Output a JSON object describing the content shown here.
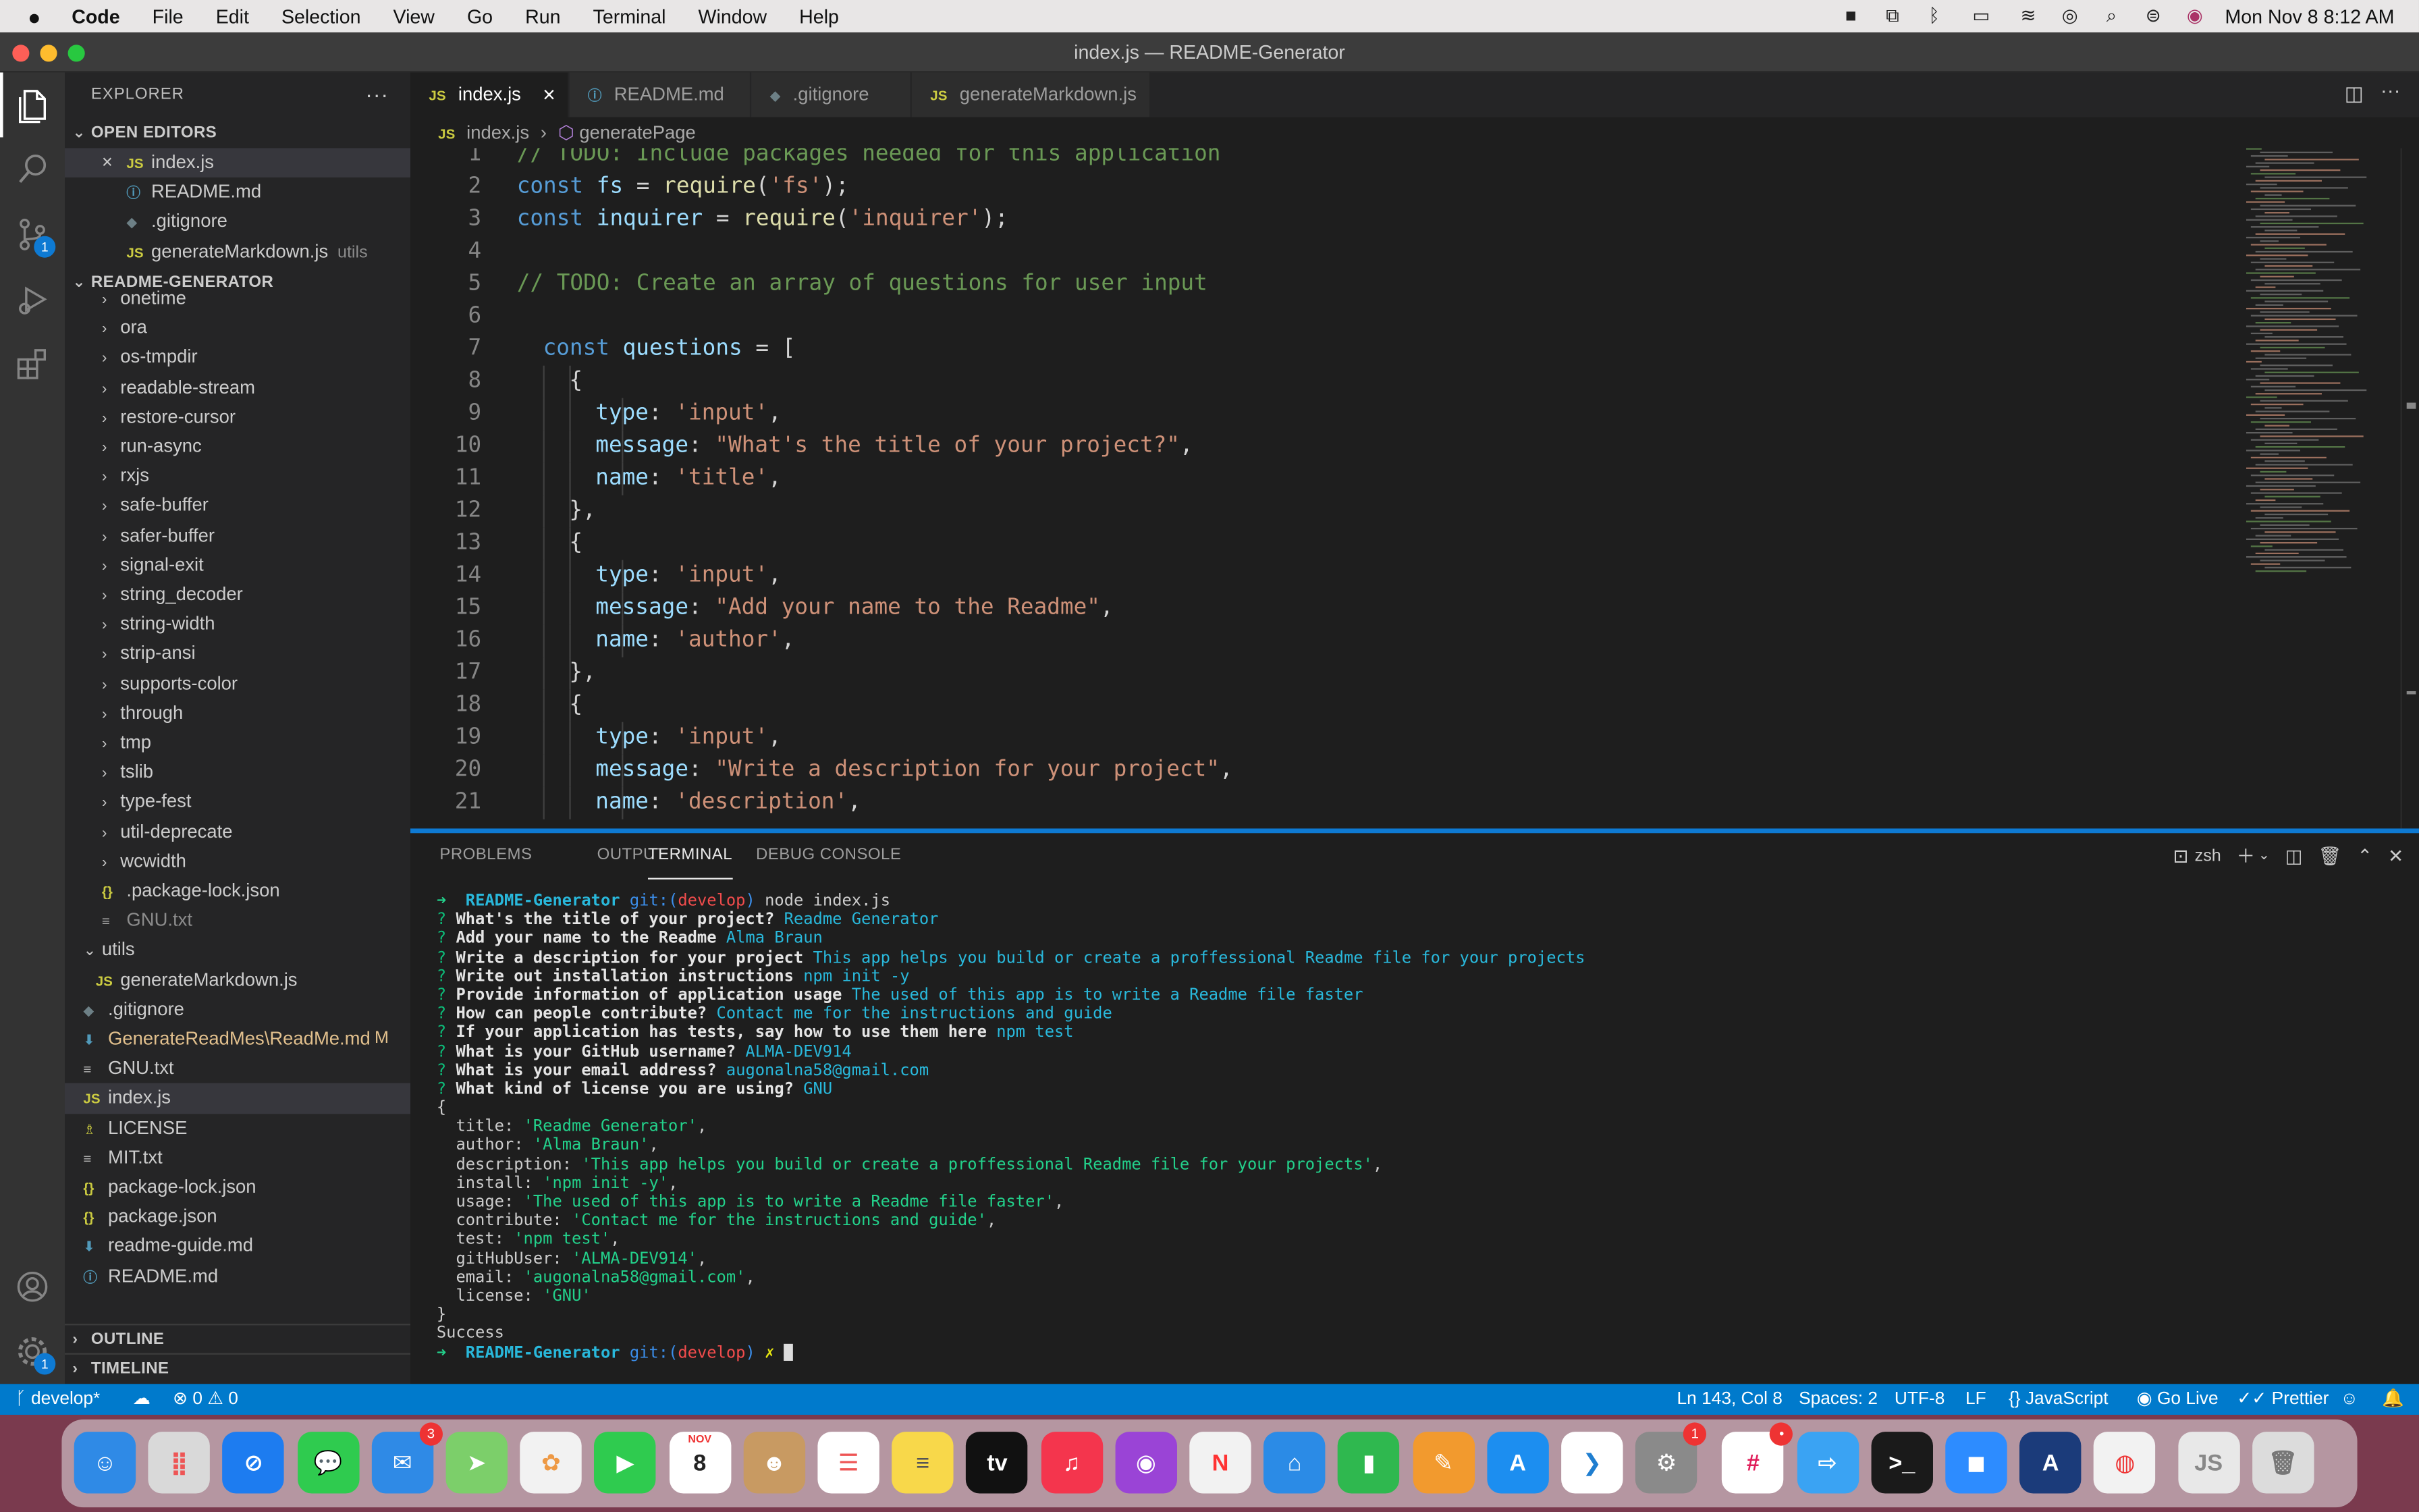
{
  "menubar": {
    "app": "Code",
    "items": [
      "File",
      "Edit",
      "Selection",
      "View",
      "Go",
      "Run",
      "Terminal",
      "Window",
      "Help"
    ],
    "datetime": "Mon Nov 8  8:12 AM"
  },
  "window": {
    "title": "index.js — README-Generator"
  },
  "activity": {
    "scm_badge": "1",
    "settings_badge": "1"
  },
  "sidebar": {
    "title": "EXPLORER",
    "open_editors_label": "OPEN EDITORS",
    "open_editors": [
      {
        "name": "index.js",
        "icon": "JS",
        "color": "#cbcb41",
        "extra": "",
        "close": "×"
      },
      {
        "name": "README.md",
        "icon": "ⓘ",
        "color": "#519aba",
        "extra": ""
      },
      {
        "name": ".gitignore",
        "icon": "◆",
        "color": "#6d8086",
        "extra": ""
      },
      {
        "name": "generateMarkdown.js",
        "icon": "JS",
        "color": "#cbcb41",
        "extra": "utils"
      }
    ],
    "project_label": "README-GENERATOR",
    "tree": [
      {
        "name": "onetime",
        "indent": 1,
        "type": "folder"
      },
      {
        "name": "ora",
        "indent": 1,
        "type": "folder"
      },
      {
        "name": "os-tmpdir",
        "indent": 1,
        "type": "folder"
      },
      {
        "name": "readable-stream",
        "indent": 1,
        "type": "folder"
      },
      {
        "name": "restore-cursor",
        "indent": 1,
        "type": "folder"
      },
      {
        "name": "run-async",
        "indent": 1,
        "type": "folder"
      },
      {
        "name": "rxjs",
        "indent": 1,
        "type": "folder"
      },
      {
        "name": "safe-buffer",
        "indent": 1,
        "type": "folder"
      },
      {
        "name": "safer-buffer",
        "indent": 1,
        "type": "folder"
      },
      {
        "name": "signal-exit",
        "indent": 1,
        "type": "folder"
      },
      {
        "name": "string_decoder",
        "indent": 1,
        "type": "folder"
      },
      {
        "name": "string-width",
        "indent": 1,
        "type": "folder"
      },
      {
        "name": "strip-ansi",
        "indent": 1,
        "type": "folder"
      },
      {
        "name": "supports-color",
        "indent": 1,
        "type": "folder"
      },
      {
        "name": "through",
        "indent": 1,
        "type": "folder"
      },
      {
        "name": "tmp",
        "indent": 1,
        "type": "folder"
      },
      {
        "name": "tslib",
        "indent": 1,
        "type": "folder"
      },
      {
        "name": "type-fest",
        "indent": 1,
        "type": "folder"
      },
      {
        "name": "util-deprecate",
        "indent": 1,
        "type": "folder"
      },
      {
        "name": "wcwidth",
        "indent": 1,
        "type": "folder"
      },
      {
        "name": ".package-lock.json",
        "indent": 1,
        "type": "file",
        "icon": "{}",
        "color": "#cbcb41"
      },
      {
        "name": "GNU.txt",
        "indent": 1,
        "type": "file",
        "icon": "≡",
        "color": "#aaa",
        "dim": true
      },
      {
        "name": "utils",
        "indent": 0,
        "type": "folder-open"
      },
      {
        "name": "generateMarkdown.js",
        "indent": 1,
        "type": "file",
        "icon": "JS",
        "color": "#cbcb41"
      },
      {
        "name": ".gitignore",
        "indent": 0,
        "type": "file",
        "icon": "◆",
        "color": "#6d8086"
      },
      {
        "name": "GenerateReadMes\\ReadMe.md",
        "indent": 0,
        "type": "file",
        "icon": "⬇",
        "color": "#519aba",
        "mod": "M",
        "modified": true
      },
      {
        "name": "GNU.txt",
        "indent": 0,
        "type": "file",
        "icon": "≡",
        "color": "#aaa"
      },
      {
        "name": "index.js",
        "indent": 0,
        "type": "file",
        "icon": "JS",
        "color": "#cbcb41",
        "selected": true
      },
      {
        "name": "LICENSE",
        "indent": 0,
        "type": "file",
        "icon": "♗",
        "color": "#cbcb41"
      },
      {
        "name": "MIT.txt",
        "indent": 0,
        "type": "file",
        "icon": "≡",
        "color": "#aaa"
      },
      {
        "name": "package-lock.json",
        "indent": 0,
        "type": "file",
        "icon": "{}",
        "color": "#cbcb41"
      },
      {
        "name": "package.json",
        "indent": 0,
        "type": "file",
        "icon": "{}",
        "color": "#cbcb41"
      },
      {
        "name": "readme-guide.md",
        "indent": 0,
        "type": "file",
        "icon": "⬇",
        "color": "#519aba"
      },
      {
        "name": "README.md",
        "indent": 0,
        "type": "file",
        "icon": "ⓘ",
        "color": "#519aba"
      }
    ],
    "outline_label": "OUTLINE",
    "timeline_label": "TIMELINE"
  },
  "tabs": [
    {
      "name": "index.js",
      "icon": "JS",
      "color": "#cbcb41",
      "active": true
    },
    {
      "name": "README.md",
      "icon": "ⓘ",
      "color": "#519aba"
    },
    {
      "name": ".gitignore",
      "icon": "◆",
      "color": "#6d8086"
    },
    {
      "name": "generateMarkdown.js",
      "icon": "JS",
      "color": "#cbcb41"
    }
  ],
  "breadcrumb": {
    "file": "index.js",
    "symbol": "generatePage"
  },
  "editor_lines": [
    {
      "n": "1",
      "indent": 0,
      "t": [
        [
          "c-com",
          "// TODO: Include packages needed for this application"
        ]
      ]
    },
    {
      "n": "2",
      "indent": 0,
      "t": [
        [
          "c-kw",
          "const "
        ],
        [
          "c-var",
          "fs"
        ],
        [
          "",
          ""
        ],
        [
          "",
          " = "
        ],
        [
          "c-fn",
          "require"
        ],
        [
          "",
          "("
        ],
        [
          "c-str",
          "'fs'"
        ],
        [
          "",
          ");"
        ]
      ]
    },
    {
      "n": "3",
      "indent": 0,
      "t": [
        [
          "c-kw",
          "const "
        ],
        [
          "c-var",
          "inquirer"
        ],
        [
          "",
          " = "
        ],
        [
          "c-fn",
          "require"
        ],
        [
          "",
          "("
        ],
        [
          "c-str",
          "'inquirer'"
        ],
        [
          "",
          ");"
        ]
      ]
    },
    {
      "n": "4",
      "indent": 0,
      "t": []
    },
    {
      "n": "5",
      "indent": 0,
      "t": [
        [
          "c-com",
          "// TODO: Create an array of questions for user input"
        ]
      ]
    },
    {
      "n": "6",
      "indent": 0,
      "t": []
    },
    {
      "n": "7",
      "indent": 1,
      "t": [
        [
          "c-kw",
          "const "
        ],
        [
          "c-var",
          "questions"
        ],
        [
          "",
          " = ["
        ]
      ]
    },
    {
      "n": "8",
      "indent": 2,
      "t": [
        [
          "",
          "{"
        ]
      ]
    },
    {
      "n": "9",
      "indent": 3,
      "t": [
        [
          "c-var",
          "type"
        ],
        [
          "",
          ": "
        ],
        [
          "c-str",
          "'input'"
        ],
        [
          "",
          ","
        ]
      ]
    },
    {
      "n": "10",
      "indent": 3,
      "t": [
        [
          "c-var",
          "message"
        ],
        [
          "",
          ": "
        ],
        [
          "c-str",
          "\"What's the title of your project?\""
        ],
        [
          "",
          ","
        ]
      ]
    },
    {
      "n": "11",
      "indent": 3,
      "t": [
        [
          "c-var",
          "name"
        ],
        [
          "",
          ": "
        ],
        [
          "c-str",
          "'title'"
        ],
        [
          "",
          ","
        ]
      ]
    },
    {
      "n": "12",
      "indent": 2,
      "t": [
        [
          "",
          "},"
        ]
      ]
    },
    {
      "n": "13",
      "indent": 2,
      "t": [
        [
          "",
          "{"
        ]
      ]
    },
    {
      "n": "14",
      "indent": 3,
      "t": [
        [
          "c-var",
          "type"
        ],
        [
          "",
          ": "
        ],
        [
          "c-str",
          "'input'"
        ],
        [
          "",
          ","
        ]
      ]
    },
    {
      "n": "15",
      "indent": 3,
      "t": [
        [
          "c-var",
          "message"
        ],
        [
          "",
          ": "
        ],
        [
          "c-str",
          "\"Add your name to the Readme\""
        ],
        [
          "",
          ","
        ]
      ]
    },
    {
      "n": "16",
      "indent": 3,
      "t": [
        [
          "c-var",
          "name"
        ],
        [
          "",
          ": "
        ],
        [
          "c-str",
          "'author'"
        ],
        [
          "",
          ","
        ]
      ]
    },
    {
      "n": "17",
      "indent": 2,
      "t": [
        [
          "",
          "},"
        ]
      ]
    },
    {
      "n": "18",
      "indent": 2,
      "t": [
        [
          "",
          "{"
        ]
      ]
    },
    {
      "n": "19",
      "indent": 3,
      "t": [
        [
          "c-var",
          "type"
        ],
        [
          "",
          ": "
        ],
        [
          "c-str",
          "'input'"
        ],
        [
          "",
          ","
        ]
      ]
    },
    {
      "n": "20",
      "indent": 3,
      "t": [
        [
          "c-var",
          "message"
        ],
        [
          "",
          ": "
        ],
        [
          "c-str",
          "\"Write a description for your project\""
        ],
        [
          "",
          ","
        ]
      ]
    },
    {
      "n": "21",
      "indent": 3,
      "t": [
        [
          "c-var",
          "name"
        ],
        [
          "",
          ": "
        ],
        [
          "c-str",
          "'description'"
        ],
        [
          "",
          ","
        ]
      ]
    }
  ],
  "panel": {
    "tabs": [
      "PROBLEMS",
      "OUTPUT",
      "TERMINAL",
      "DEBUG CONSOLE"
    ],
    "active": "TERMINAL",
    "shell": "zsh"
  },
  "terminal_lines": [
    [
      [
        "t-g",
        "➜  "
      ],
      [
        "t-c t-bold",
        "README-Generator "
      ],
      [
        "t-bl",
        "git:("
      ],
      [
        "t-r",
        "develop"
      ],
      [
        "t-bl",
        ")"
      ],
      [
        "",
        " node index.js"
      ]
    ],
    [
      [
        "t-gr",
        "? "
      ],
      [
        "t-b",
        "What's the title of your project? "
      ],
      [
        "t-c",
        "Readme Generator"
      ]
    ],
    [
      [
        "t-gr",
        "? "
      ],
      [
        "t-b",
        "Add your name to the Readme "
      ],
      [
        "t-c",
        "Alma Braun"
      ]
    ],
    [
      [
        "t-gr",
        "? "
      ],
      [
        "t-b",
        "Write a description for your project "
      ],
      [
        "t-c",
        "This app helps you build or create a proffessional Readme file for your projects"
      ]
    ],
    [
      [
        "t-gr",
        "? "
      ],
      [
        "t-b",
        "Write out installation instructions "
      ],
      [
        "t-c",
        "npm init -y"
      ]
    ],
    [
      [
        "t-gr",
        "? "
      ],
      [
        "t-b",
        "Provide information of application usage "
      ],
      [
        "t-c",
        "The used of this app is to write a Readme file faster"
      ]
    ],
    [
      [
        "t-gr",
        "? "
      ],
      [
        "t-b",
        "How can people contribute? "
      ],
      [
        "t-c",
        "Contact me for the instructions and guide"
      ]
    ],
    [
      [
        "t-gr",
        "? "
      ],
      [
        "t-b",
        "If your application has tests, say how to use them here "
      ],
      [
        "t-c",
        "npm test"
      ]
    ],
    [
      [
        "t-gr",
        "? "
      ],
      [
        "t-b",
        "What is your GitHub username? "
      ],
      [
        "t-c",
        "ALMA-DEV914"
      ]
    ],
    [
      [
        "t-gr",
        "? "
      ],
      [
        "t-b",
        "What is your email address? "
      ],
      [
        "t-c",
        "augonalna58@gmail.com"
      ]
    ],
    [
      [
        "t-gr",
        "? "
      ],
      [
        "t-b",
        "What kind of license you are using? "
      ],
      [
        "t-c",
        "GNU"
      ]
    ],
    [
      [
        "",
        "{"
      ]
    ],
    [
      [
        "",
        "  title: "
      ],
      [
        "t-g",
        "'Readme Generator'"
      ],
      [
        "",
        ","
      ]
    ],
    [
      [
        "",
        "  author: "
      ],
      [
        "t-g",
        "'Alma Braun'"
      ],
      [
        "",
        ","
      ]
    ],
    [
      [
        "",
        "  description: "
      ],
      [
        "t-g",
        "'This app helps you build or create a proffessional Readme file for your projects'"
      ],
      [
        "",
        ","
      ]
    ],
    [
      [
        "",
        "  install: "
      ],
      [
        "t-g",
        "'npm init -y'"
      ],
      [
        "",
        ","
      ]
    ],
    [
      [
        "",
        "  usage: "
      ],
      [
        "t-g",
        "'The used of this app is to write a Readme file faster'"
      ],
      [
        "",
        ","
      ]
    ],
    [
      [
        "",
        "  contribute: "
      ],
      [
        "t-g",
        "'Contact me for the instructions and guide'"
      ],
      [
        "",
        ","
      ]
    ],
    [
      [
        "",
        "  test: "
      ],
      [
        "t-g",
        "'npm test'"
      ],
      [
        "",
        ","
      ]
    ],
    [
      [
        "",
        "  gitHubUser: "
      ],
      [
        "t-g",
        "'ALMA-DEV914'"
      ],
      [
        "",
        ","
      ]
    ],
    [
      [
        "",
        "  email: "
      ],
      [
        "t-g",
        "'augonalna58@gmail.com'"
      ],
      [
        "",
        ","
      ]
    ],
    [
      [
        "",
        "  license: "
      ],
      [
        "t-g",
        "'GNU'"
      ]
    ],
    [
      [
        "",
        "}"
      ]
    ],
    [
      [
        "",
        "Success"
      ]
    ],
    [
      [
        "t-g",
        "➜  "
      ],
      [
        "t-c t-bold",
        "README-Generator "
      ],
      [
        "t-bl",
        "git:("
      ],
      [
        "t-r",
        "develop"
      ],
      [
        "t-bl",
        ")"
      ],
      [
        "t-y",
        " ✗ "
      ]
    ]
  ],
  "status": {
    "branch": "develop*",
    "errors": "0",
    "warnings": "0",
    "position": "Ln 143, Col 8",
    "spaces": "Spaces: 2",
    "encoding": "UTF-8",
    "eol": "LF",
    "language": "JavaScript",
    "golive": "Go Live",
    "prettier": "Prettier"
  },
  "dock": [
    {
      "name": "finder-icon",
      "color": "#2f8ae6",
      "label": "☺"
    },
    {
      "name": "launchpad-icon",
      "color": "#d9d9d9",
      "label": "⣿",
      "fg": "#e55"
    },
    {
      "name": "safari-icon",
      "color": "#1d7cf0",
      "label": "⊘"
    },
    {
      "name": "messages-icon",
      "color": "#2fcb4f",
      "label": "💬"
    },
    {
      "name": "mail-icon",
      "color": "#2f8ae6",
      "label": "✉",
      "badge": "3"
    },
    {
      "name": "maps-icon",
      "color": "#7ccf6a",
      "label": "➤"
    },
    {
      "name": "photos-icon",
      "color": "#f2f2f2",
      "label": "✿",
      "fg": "#e94"
    },
    {
      "name": "facetime-icon",
      "color": "#2fcb4f",
      "label": "▶"
    },
    {
      "name": "calendar-icon",
      "color": "#ffffff",
      "label": "8",
      "fg": "#222",
      "top": "NOV"
    },
    {
      "name": "contacts-icon",
      "color": "#c89a62",
      "label": "☻"
    },
    {
      "name": "reminders-icon",
      "color": "#ffffff",
      "label": "☰",
      "fg": "#e55"
    },
    {
      "name": "notes-icon",
      "color": "#f8d84a",
      "label": "≡",
      "fg": "#555"
    },
    {
      "name": "apple-tv-icon",
      "color": "#111111",
      "label": "tv"
    },
    {
      "name": "music-icon",
      "color": "#f4354d",
      "label": "♫"
    },
    {
      "name": "podcasts-icon",
      "color": "#9a44d6",
      "label": "◉"
    },
    {
      "name": "news-icon",
      "color": "#f2f2f2",
      "label": "N",
      "fg": "#f33"
    },
    {
      "name": "keynote-icon",
      "color": "#2b8be6",
      "label": "⌂"
    },
    {
      "name": "numbers-icon",
      "color": "#2fb84f",
      "label": "▮"
    },
    {
      "name": "pages-icon",
      "color": "#f29a2e",
      "label": "✎"
    },
    {
      "name": "app-store-icon",
      "color": "#1c8ef0",
      "label": "A"
    },
    {
      "name": "vscode-icon",
      "color": "#ffffff",
      "label": "❯",
      "fg": "#1f7ed0"
    },
    {
      "name": "system-preferences-icon",
      "color": "#8a8a8a",
      "label": "⚙",
      "badge": "1"
    },
    {
      "name": "slack-icon",
      "color": "#ffffff",
      "label": "#",
      "fg": "#e01e5a",
      "badge": "•"
    },
    {
      "name": "migration-icon",
      "color": "#3aa3f3",
      "label": "⇨"
    },
    {
      "name": "terminal-icon",
      "color": "#1a1a1a",
      "label": ">_"
    },
    {
      "name": "zoom-icon",
      "color": "#2d8cff",
      "label": "◼"
    },
    {
      "name": "xcode-instruments-icon",
      "color": "#1b3b7a",
      "label": "A"
    },
    {
      "name": "chrome-icon",
      "color": "#f2f2f2",
      "label": "◍",
      "fg": "#e33"
    },
    {
      "name": "document-icon",
      "color": "#e8e8e8",
      "label": "JS",
      "fg": "#888"
    },
    {
      "name": "trash-icon",
      "color": "#dcdcdc",
      "label": "🗑",
      "fg": "#777"
    }
  ]
}
